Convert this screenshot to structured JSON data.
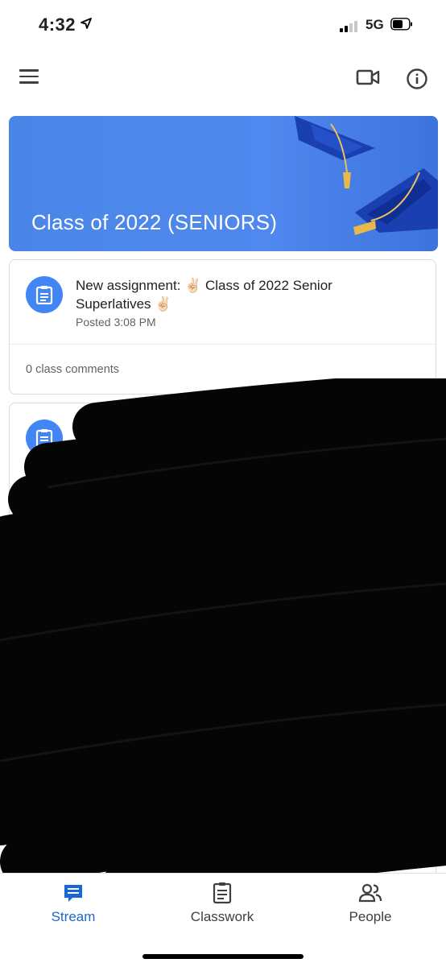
{
  "status_bar": {
    "time": "4:32",
    "network": "5G"
  },
  "app_bar": {
    "icons": [
      "menu-icon",
      "video-camera-icon",
      "info-icon"
    ]
  },
  "banner": {
    "title": "Class of 2022 (SENIORS)",
    "color": "#4a86e8"
  },
  "posts": [
    {
      "title": "New assignment: ✌🏻 Class of 2022 Senior Superlatives ✌🏻",
      "date": "Posted 3:08 PM",
      "comments": "0 class comments",
      "icon": "assignment-icon"
    }
  ],
  "bottom_nav": {
    "items": [
      {
        "label": "Stream",
        "icon": "stream-icon",
        "active": true
      },
      {
        "label": "Classwork",
        "icon": "classwork-icon",
        "active": false
      },
      {
        "label": "People",
        "icon": "people-icon",
        "active": false
      }
    ],
    "active_color": "#1967d2"
  }
}
